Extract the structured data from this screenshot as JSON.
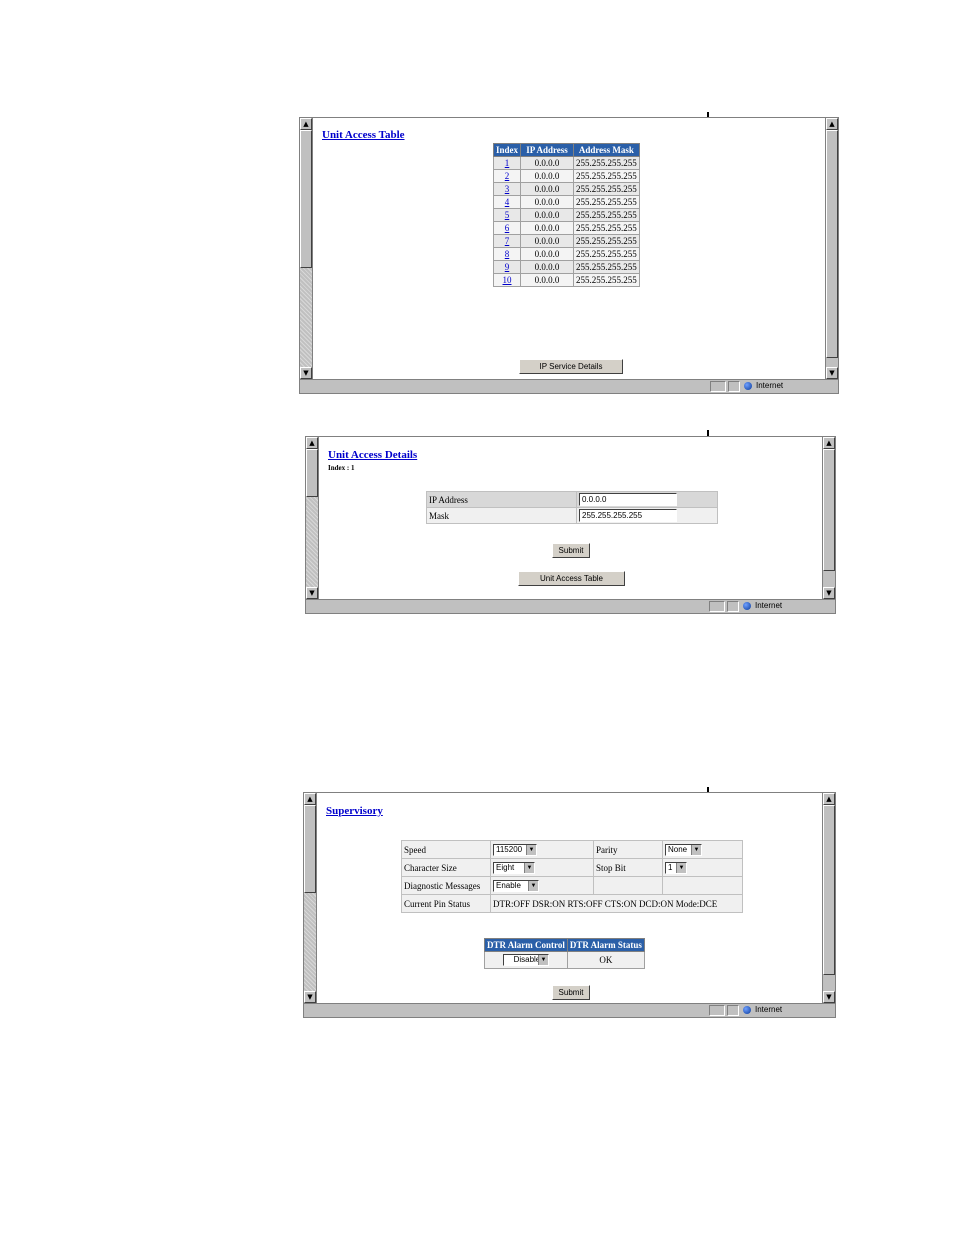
{
  "colors": {
    "header_blue": "#2a5fa8",
    "link_blue": "#0000cc",
    "chrome_gray": "#c0c0c0"
  },
  "icons": {
    "scroll_up": "▲",
    "scroll_down": "▼",
    "dropdown": "▼",
    "zone_globe": "globe-icon"
  },
  "window1": {
    "title": "Unit Access Table",
    "table": {
      "headers": [
        "Index",
        "IP Address",
        "Address Mask"
      ],
      "rows": [
        {
          "index": "1",
          "ip": "0.0.0.0",
          "mask": "255.255.255.255"
        },
        {
          "index": "2",
          "ip": "0.0.0.0",
          "mask": "255.255.255.255"
        },
        {
          "index": "3",
          "ip": "0.0.0.0",
          "mask": "255.255.255.255"
        },
        {
          "index": "4",
          "ip": "0.0.0.0",
          "mask": "255.255.255.255"
        },
        {
          "index": "5",
          "ip": "0.0.0.0",
          "mask": "255.255.255.255"
        },
        {
          "index": "6",
          "ip": "0.0.0.0",
          "mask": "255.255.255.255"
        },
        {
          "index": "7",
          "ip": "0.0.0.0",
          "mask": "255.255.255.255"
        },
        {
          "index": "8",
          "ip": "0.0.0.0",
          "mask": "255.255.255.255"
        },
        {
          "index": "9",
          "ip": "0.0.0.0",
          "mask": "255.255.255.255"
        },
        {
          "index": "10",
          "ip": "0.0.0.0",
          "mask": "255.255.255.255"
        }
      ]
    },
    "button": "IP Service Details",
    "status_zone": "Internet"
  },
  "window2": {
    "title": "Unit Access Details",
    "subtitle": "Index : 1",
    "fields": {
      "ip_label": "IP Address",
      "ip_value": "0.0.0.0",
      "mask_label": "Mask",
      "mask_value": "255.255.255.255"
    },
    "submit": "Submit",
    "back_button": "Unit Access Table",
    "status_zone": "Internet"
  },
  "window3": {
    "title": "Supervisory",
    "speed_label": "Speed",
    "speed_value": "115200",
    "parity_label": "Parity",
    "parity_value": "None",
    "charsize_label": "Character Size",
    "charsize_value": "Eight",
    "stopbit_label": "Stop Bit",
    "stopbit_value": "1",
    "diag_label": "Diagnostic Messages",
    "diag_value": "Enable",
    "pin_label": "Current Pin Status",
    "pin_value": "DTR:OFF DSR:ON RTS:OFF CTS:ON DCD:ON Mode:DCE",
    "dtr_headers": [
      "DTR Alarm Control",
      "DTR Alarm Status"
    ],
    "dtr_control_value": "Disable",
    "dtr_status_value": "OK",
    "submit": "Submit",
    "status_zone": "Internet"
  }
}
